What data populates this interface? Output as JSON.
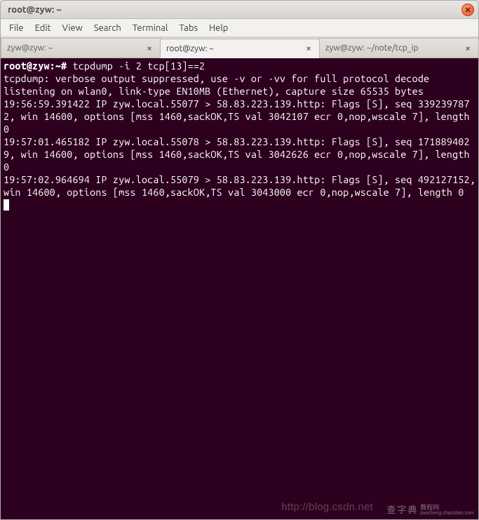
{
  "window": {
    "title": "root@zyw: ~"
  },
  "menu": {
    "items": [
      "File",
      "Edit",
      "View",
      "Search",
      "Terminal",
      "Tabs",
      "Help"
    ]
  },
  "tabs": [
    {
      "label": "zyw@zyw: ~",
      "active": false
    },
    {
      "label": "root@zyw: ~",
      "active": true
    },
    {
      "label": "zyw@zyw: ~/note/tcp_ip",
      "active": false
    }
  ],
  "terminal": {
    "prompt": "root@zyw:~#",
    "command": "tcpdump -i 2 tcp[13]==2",
    "lines": [
      "tcpdump: verbose output suppressed, use -v or -vv for full protocol decode",
      "listening on wlan0, link-type EN10MB (Ethernet), capture size 65535 bytes",
      "19:56:59.391422 IP zyw.local.55077 > 58.83.223.139.http: Flags [S], seq 3392397872, win 14600, options [mss 1460,sackOK,TS val 3042107 ecr 0,nop,wscale 7], length 0",
      "19:57:01.465182 IP zyw.local.55078 > 58.83.223.139.http: Flags [S], seq 1718894029, win 14600, options [mss 1460,sackOK,TS val 3042626 ecr 0,nop,wscale 7], length 0",
      "19:57:02.964694 IP zyw.local.55079 > 58.83.223.139.http: Flags [S], seq 492127152, win 14600, options [mss 1460,sackOK,TS val 3043000 ecr 0,nop,wscale 7], length 0"
    ]
  },
  "watermarks": {
    "url": "http://blog.csdn.net",
    "brand": "查字典",
    "brand_sub": "教程网",
    "brand_domain": "jiaocheng.chazidian.com"
  }
}
